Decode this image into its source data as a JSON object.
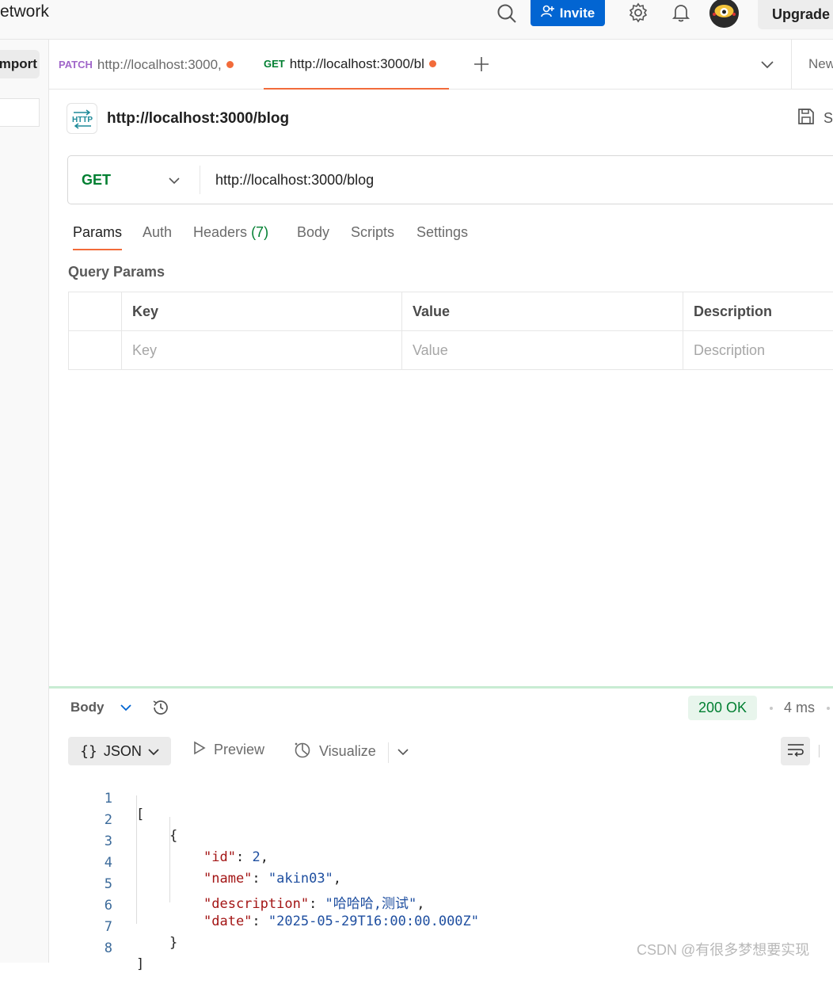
{
  "topbar": {
    "workspace_title": "etwork",
    "invite_label": "Invite",
    "upgrade_label": "Upgrade"
  },
  "sidebar": {
    "import_label": "Import"
  },
  "tabs": [
    {
      "method": "PATCH",
      "label": "http://localhost:3000,",
      "method_color": "#a066c9"
    },
    {
      "method": "GET",
      "label": "http://localhost:3000/bl",
      "method_color": "#007f31"
    }
  ],
  "tabs_new_label": "New",
  "request": {
    "name": "http://localhost:3000/blog",
    "http_icon_text": "HTTP",
    "save_label": "S",
    "method": "GET",
    "url": "http://localhost:3000/blog"
  },
  "subtabs": {
    "params": "Params",
    "auth": "Auth",
    "headers": "Headers",
    "headers_count": "(7)",
    "body": "Body",
    "scripts": "Scripts",
    "settings": "Settings"
  },
  "query_params": {
    "title": "Query Params",
    "headers": [
      "Key",
      "Value",
      "Description"
    ],
    "placeholders": [
      "Key",
      "Value",
      "Description"
    ]
  },
  "response": {
    "body_label": "Body",
    "status": "200 OK",
    "time": "4 ms",
    "format_label": "JSON",
    "format_icon": "{}",
    "preview_label": "Preview",
    "visualize_label": "Visualize",
    "code_lines": [
      {
        "n": "1",
        "text": "["
      },
      {
        "n": "2",
        "text": "{"
      },
      {
        "n": "3",
        "key": "\"id\"",
        "val": "2",
        "tail": ","
      },
      {
        "n": "4",
        "key": "\"name\"",
        "val": "\"akin03\"",
        "tail": ","
      },
      {
        "n": "5",
        "key": "\"description\"",
        "val": "\"哈哈哈,测试\"",
        "tail": ","
      },
      {
        "n": "6",
        "key": "\"date\"",
        "val": "\"2025-05-29T16:00:00.000Z\"",
        "tail": ""
      },
      {
        "n": "7",
        "text": "}"
      },
      {
        "n": "8",
        "text": "]"
      }
    ]
  },
  "watermark": "CSDN @有很多梦想要实现",
  "colors": {
    "accent_orange": "#f26b3a",
    "invite_blue": "#0265d2",
    "get_green": "#007f31"
  }
}
